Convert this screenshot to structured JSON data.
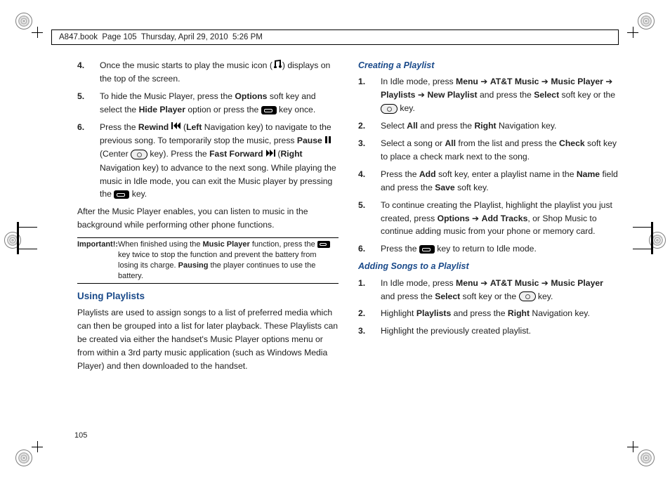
{
  "header": {
    "book": "A847.book",
    "page_ref": "Page 105",
    "date": "Thursday, April 29, 2010",
    "time": "5:26 PM"
  },
  "page_number": "105",
  "left_col": {
    "steps_a": [
      {
        "n": "4.",
        "pre": "Once the music starts to play the music icon (",
        "post": ") displays on the top of the screen."
      },
      {
        "n": "5.",
        "a": "To hide the Music Player, press the ",
        "b1": "Options",
        "c": " soft key and select the ",
        "b2": "Hide Player",
        "d": " option or press the ",
        "e": " key once."
      },
      {
        "n": "6.",
        "a": "Press the ",
        "b1": "Rewind ",
        "c": " (",
        "b2": "Left",
        "d": " Navigation key) to navigate to the previous song. To temporarily stop the music, press ",
        "b3": "Pause ",
        "e": " (Center ",
        "f": " key). Press the ",
        "b4": "Fast Forward ",
        "g": " (",
        "b5": "Right",
        "h": " Navigation key) to advance to the next song. While playing the music in Idle mode, you can exit the Music player by pressing the ",
        "i": " key."
      }
    ],
    "after_para": "After the Music Player enables, you can listen to music in the background while performing other phone functions.",
    "important_label": "Important!:",
    "important_a": "When finished using the ",
    "important_b1": "Music Player",
    "important_c": " function, press the ",
    "important_d": " key twice to stop the function and prevent the battery from losing its charge. ",
    "important_b2": "Pausing",
    "important_e": " the player continues to use the battery.",
    "section": "Using Playlists",
    "playlists_para": "Playlists are used to assign songs to a list of preferred media which can then be grouped into a list for later playback. These Playlists can be created via either the handset's Music Player options menu or from within a 3rd party music application (such as Windows Media Player) and then downloaded to the handset."
  },
  "right_col": {
    "sub1": "Creating a Playlist",
    "steps1": [
      {
        "n": "1.",
        "a": "In Idle mode, press ",
        "b1": "Menu",
        "arr1": " ➔ ",
        "b2": "AT&T Music",
        "arr2": " ➔ ",
        "b3": "Music Player",
        "arr3": " ➔ ",
        "b4": "Playlists",
        "arr4": " ➔ ",
        "b5": "New Playlist",
        "c": " and press the ",
        "b6": "Select",
        "d": " soft key or the ",
        "e": " key."
      },
      {
        "n": "2.",
        "a": "Select ",
        "b1": "All",
        "c": " and press the ",
        "b2": "Right",
        "d": " Navigation key."
      },
      {
        "n": "3.",
        "a": "Select a song or ",
        "b1": "All",
        "c": " from the list and press the ",
        "b2": "Check",
        "d": " soft key to place a check mark next to the song."
      },
      {
        "n": "4.",
        "a": "Press the ",
        "b1": "Add",
        "c": " soft key, enter a playlist name in the ",
        "b2": "Name",
        "d": " field and press the ",
        "b3": "Save",
        "e": " soft key."
      },
      {
        "n": "5.",
        "a": "To continue creating the Playlist, highlight the playlist you just created, press ",
        "b1": "Options",
        "arr1": " ➔ ",
        "b2": "Add Tracks",
        "c": ", or Shop Music to continue adding music from your phone or memory card."
      },
      {
        "n": "6.",
        "a": "Press the ",
        "c": " key to return to Idle mode."
      }
    ],
    "sub2": "Adding Songs to a Playlist",
    "steps2": [
      {
        "n": "1.",
        "a": "In Idle mode, press ",
        "b1": "Menu",
        "arr1": " ➔ ",
        "b2": "AT&T Music",
        "arr2": " ➔ ",
        "b3": "Music Player",
        "c": " and press the ",
        "b4": "Select",
        "d": " soft key or the ",
        "e": " key."
      },
      {
        "n": "2.",
        "a": "Highlight ",
        "b1": "Playlists",
        "c": " and press the ",
        "b2": "Right",
        "d": " Navigation key."
      },
      {
        "n": "3.",
        "a": "Highlight the previously created playlist."
      }
    ]
  }
}
